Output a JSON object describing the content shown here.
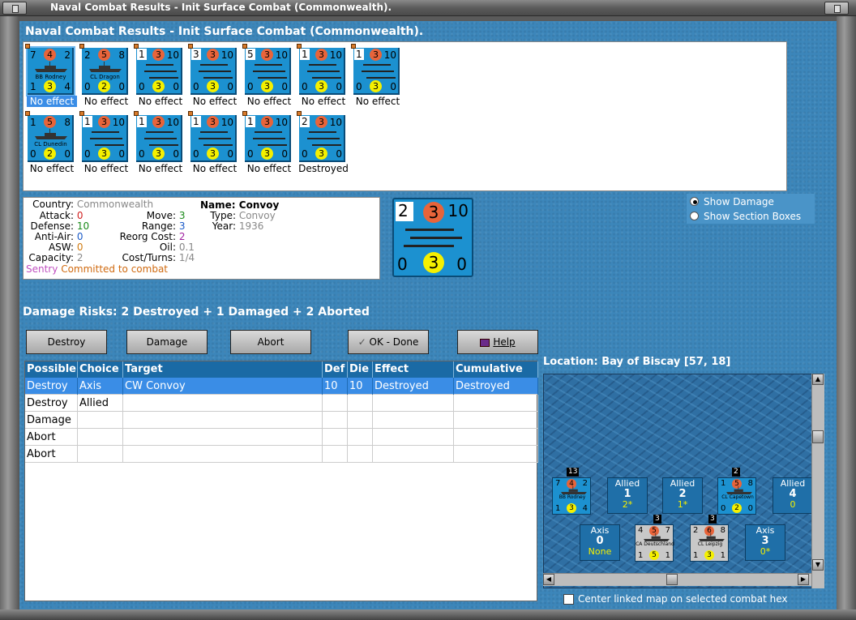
{
  "window": {
    "title": "Naval Combat Results - Init Surface Combat (Commonwealth)."
  },
  "main_title": "Naval Combat Results - Init Surface Combat (Commonwealth).",
  "units": [
    {
      "attack": "7",
      "aa": "4",
      "move": "2",
      "def": "1",
      "asw": "3",
      "range": "4",
      "name": "BB Rodney",
      "effect": "No effect"
    },
    {
      "attack": "2",
      "aa": "5",
      "move": "8",
      "def": "0",
      "asw": "2",
      "range": "0",
      "name": "CL Dragon",
      "effect": "No effect"
    },
    {
      "attack": "1",
      "aa": "3",
      "move": "10",
      "def": "0",
      "asw": "3",
      "range": "0",
      "name": "",
      "effect": "No effect"
    },
    {
      "attack": "3",
      "aa": "3",
      "move": "10",
      "def": "0",
      "asw": "3",
      "range": "0",
      "name": "",
      "effect": "No effect"
    },
    {
      "attack": "5",
      "aa": "3",
      "move": "10",
      "def": "0",
      "asw": "3",
      "range": "0",
      "name": "",
      "effect": "No effect"
    },
    {
      "attack": "1",
      "aa": "3",
      "move": "10",
      "def": "0",
      "asw": "3",
      "range": "0",
      "name": "",
      "effect": "No effect"
    },
    {
      "attack": "1",
      "aa": "3",
      "move": "10",
      "def": "0",
      "asw": "3",
      "range": "0",
      "name": "",
      "effect": "No effect"
    },
    {
      "attack": "1",
      "aa": "5",
      "move": "8",
      "def": "0",
      "asw": "2",
      "range": "0",
      "name": "CL Dunedin",
      "effect": "No effect"
    },
    {
      "attack": "1",
      "aa": "3",
      "move": "10",
      "def": "0",
      "asw": "3",
      "range": "0",
      "name": "",
      "effect": "No effect"
    },
    {
      "attack": "1",
      "aa": "3",
      "move": "10",
      "def": "0",
      "asw": "3",
      "range": "0",
      "name": "",
      "effect": "No effect"
    },
    {
      "attack": "1",
      "aa": "3",
      "move": "10",
      "def": "0",
      "asw": "3",
      "range": "0",
      "name": "",
      "effect": "No effect"
    },
    {
      "attack": "1",
      "aa": "3",
      "move": "10",
      "def": "0",
      "asw": "3",
      "range": "0",
      "name": "",
      "effect": "No effect"
    },
    {
      "attack": "2",
      "aa": "3",
      "move": "10",
      "def": "0",
      "asw": "3",
      "range": "0",
      "name": "",
      "effect": "Destroyed"
    }
  ],
  "info": {
    "country_label": "Country:",
    "country": "Commonwealth",
    "attack_label": "Attack:",
    "attack": "0",
    "defense_label": "Defense:",
    "defense": "10",
    "antiair_label": "Anti-Air:",
    "antiair": "0",
    "asw_label": "ASW:",
    "asw": "0",
    "capacity_label": "Capacity:",
    "capacity": "2",
    "move_label": "Move:",
    "move": "3",
    "range_label": "Range:",
    "range": "3",
    "reorg_label": "Reorg Cost:",
    "reorg": "2",
    "oil_label": "Oil:",
    "oil": "0.1",
    "cost_label": "Cost/Turns:",
    "cost": "1/4",
    "name_label": "Name:",
    "name": "Convoy",
    "type_label": "Type:",
    "type": "Convoy",
    "year_label": "Year:",
    "year": "1936",
    "sentry": "Sentry",
    "committed": "Committed to combat"
  },
  "big_counter": {
    "attack": "2",
    "aa": "3",
    "move": "10",
    "def": "0",
    "asw": "3",
    "range": "0"
  },
  "radios": {
    "show_damage": "Show Damage",
    "show_sections": "Show Section Boxes"
  },
  "damage_risks": "Damage Risks:  2 Destroyed + 1 Damaged + 2 Aborted",
  "buttons": {
    "destroy": "Destroy",
    "damage": "Damage",
    "abort": "Abort",
    "ok": "OK - Done",
    "help": "Help"
  },
  "table": {
    "headers": [
      "Possible",
      "Choice",
      "Target",
      "Def",
      "Die",
      "Effect",
      "Cumulative"
    ],
    "rows": [
      [
        "Destroy",
        "Axis",
        "CW Convoy",
        "10",
        "10",
        "Destroyed",
        "Destroyed"
      ],
      [
        "Destroy",
        "Allied",
        "",
        "",
        "",
        "",
        ""
      ],
      [
        "Damage",
        "",
        "",
        "",
        "",
        "",
        ""
      ],
      [
        "Abort",
        "",
        "",
        "",
        "",
        "",
        ""
      ],
      [
        "Abort",
        "",
        "",
        "",
        "",
        "",
        ""
      ]
    ]
  },
  "location": "Location:  Bay of Biscay [57, 18]",
  "map": {
    "top_row": [
      {
        "kind": "card",
        "attack": "7",
        "aa": "4",
        "move": "2",
        "def": "1",
        "asw": "3",
        "range": "4",
        "name": "BB Rodney",
        "badge": "13"
      },
      {
        "kind": "box",
        "side": "Allied",
        "value": "1",
        "sub": "2*"
      },
      {
        "kind": "box",
        "side": "Allied",
        "value": "2",
        "sub": "1*"
      },
      {
        "kind": "card",
        "attack": "1",
        "aa": "5",
        "move": "8",
        "def": "0",
        "asw": "2",
        "range": "0",
        "name": "CL Capetown",
        "badge": "2"
      },
      {
        "kind": "box",
        "side": "Allied",
        "value": "4",
        "sub": "0"
      }
    ],
    "bottom_row": [
      {
        "kind": "box",
        "side": "Axis",
        "value": "0",
        "sub": "None"
      },
      {
        "kind": "card",
        "attack": "4",
        "aa": "5",
        "move": "7",
        "def": "1",
        "asw": "5",
        "range": "1",
        "name": "CA Deutschland",
        "badge": "3"
      },
      {
        "kind": "card",
        "attack": "2",
        "aa": "6",
        "move": "8",
        "def": "1",
        "asw": "3",
        "range": "1",
        "name": "CL Leipzig",
        "badge": "3"
      },
      {
        "kind": "box",
        "side": "Axis",
        "value": "3",
        "sub": "0*"
      }
    ]
  },
  "center_map_label": "Center linked map on selected combat hex",
  "colors": {
    "panel_blue": "#3c86ba",
    "counter_blue": "#1c91d0",
    "axis_gray": "#c8c8c8",
    "orange": "#e8643a",
    "yellow": "#f5f000",
    "selection": "#3a8de6"
  }
}
